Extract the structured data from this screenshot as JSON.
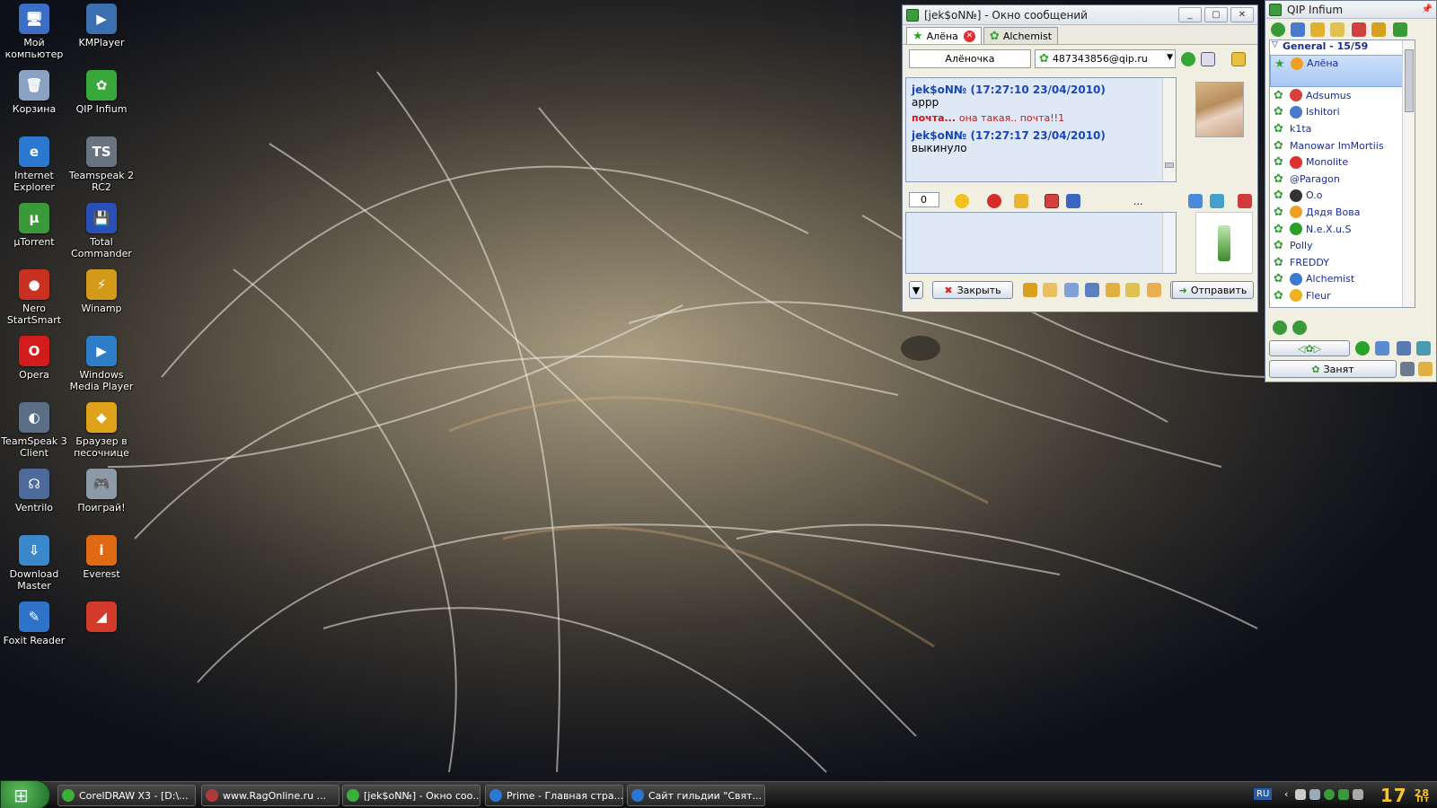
{
  "desktop": {
    "icons": [
      {
        "label": "Мой компьютер",
        "glyph": "🖥",
        "color": "#3c6fc4"
      },
      {
        "label": "KMPlayer",
        "glyph": "▶",
        "color": "#3b6fb0"
      },
      {
        "label": "Корзина",
        "glyph": "🗑",
        "color": "#8aa3c2"
      },
      {
        "label": "QIP Infium",
        "glyph": "✿",
        "color": "#39a83a"
      },
      {
        "label": "Internet Explorer",
        "glyph": "e",
        "color": "#2a78d0"
      },
      {
        "label": "Teamspeak 2 RC2",
        "glyph": "TS",
        "color": "#6a7480"
      },
      {
        "label": "µTorrent",
        "glyph": "µ",
        "color": "#3a9a3a"
      },
      {
        "label": "Total Commander",
        "glyph": "💾",
        "color": "#2a4fb5"
      },
      {
        "label": "Nero StartSmart",
        "glyph": "●",
        "color": "#c8301f"
      },
      {
        "label": "Winamp",
        "glyph": "⚡",
        "color": "#d39a1a"
      },
      {
        "label": "Opera",
        "glyph": "O",
        "color": "#d21b1b"
      },
      {
        "label": "Windows Media Player",
        "glyph": "▶",
        "color": "#2e7dc8"
      },
      {
        "label": "TeamSpeak 3 Client",
        "glyph": "◐",
        "color": "#5a6e86"
      },
      {
        "label": "Браузер в песочнице",
        "glyph": "◆",
        "color": "#e0a21a"
      },
      {
        "label": "Ventrilo",
        "glyph": "☊",
        "color": "#4d6a9a"
      },
      {
        "label": "Поиграй!",
        "glyph": "🎮",
        "color": "#8c9aa8"
      },
      {
        "label": "Download Master",
        "glyph": "⇩",
        "color": "#3a88c9"
      },
      {
        "label": "Everest",
        "glyph": "i",
        "color": "#e06a13"
      },
      {
        "label": "Foxit Reader",
        "glyph": "✎",
        "color": "#2f73c9"
      },
      {
        "label": "",
        "glyph": "◢",
        "color": "#d23a2a"
      }
    ]
  },
  "chat_window": {
    "title": "[jek$oN№] - Окно сообщений",
    "tabs": [
      {
        "label": "Алёна"
      },
      {
        "label": "Alchemist"
      }
    ],
    "contact_name": "Алёночка",
    "contact_account": "487343856@qip.ru",
    "messages": [
      {
        "header": "jek$oN№ (17:27:10 23/04/2010)",
        "text": "аррр"
      },
      {
        "sender": "почта...",
        "text": "она такая.. почта!!1"
      },
      {
        "header": "jek$oN№ (17:27:17 23/04/2010)",
        "text": "выкинуло"
      }
    ],
    "char_count": "0",
    "more_label": "...",
    "close_button": "Закрыть",
    "send_button": "Отправить"
  },
  "contact_list": {
    "title": "QIP Infium",
    "group": "General - 15/59",
    "contacts": [
      {
        "name": "Алёна",
        "selected": true,
        "smiley": "#f0a020"
      },
      {
        "name": "Adsumus",
        "smiley": "#d84040"
      },
      {
        "name": "Ishitori",
        "smiley": "#4a7ad0"
      },
      {
        "name": "k1ta",
        "smiley": ""
      },
      {
        "name": "Manowar ImMortiis",
        "smiley": ""
      },
      {
        "name": "Monolite",
        "smiley": "#e03030"
      },
      {
        "name": "@Paragon",
        "smiley": ""
      },
      {
        "name": "O.o",
        "smiley": "#333333"
      },
      {
        "name": "Дядя Вова",
        "smiley": "#f0a020"
      },
      {
        "name": "N.e.X.u.S",
        "smiley": "#2aa02a"
      },
      {
        "name": "Polly",
        "smiley": ""
      },
      {
        "name": "FREDDY",
        "smiley": ""
      },
      {
        "name": "Alchemist",
        "smiley": "#3a7ad0"
      },
      {
        "name": "Fleur",
        "smiley": "#f0b020"
      }
    ],
    "status_button": "Занят"
  },
  "taskbar": {
    "items": [
      {
        "label": "CorelDRAW X3 - [D:\\...",
        "color": "#3ab03a"
      },
      {
        "label": "www.RagOnline.ru   ...",
        "color": "#b03a3a"
      },
      {
        "label": "[jek$oN№] - Окно соо...",
        "color": "#3ab03a"
      },
      {
        "label": "Prime - Главная стра...",
        "color": "#2a78d0"
      },
      {
        "label": "Сайт гильдии \"Свят...",
        "color": "#2a78d0"
      }
    ],
    "lang": "RU",
    "clock_hour": "17",
    "clock_min": "28",
    "clock_day": "Пт"
  }
}
